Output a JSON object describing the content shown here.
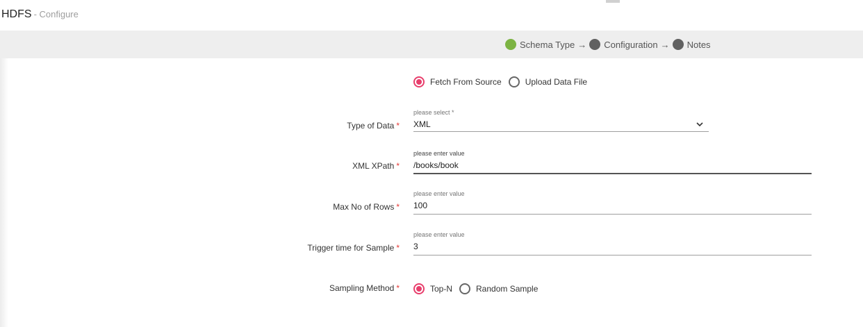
{
  "header": {
    "title": "HDFS",
    "subtitle": "- Configure"
  },
  "steps": [
    {
      "label": "Schema Type",
      "arrow": "→",
      "color": "#7cb342"
    },
    {
      "label": "Configuration",
      "arrow": "→",
      "color": "#616161"
    },
    {
      "label": "Notes",
      "arrow": "",
      "color": "#616161"
    }
  ],
  "source_options": {
    "selected": "Fetch From Source",
    "options": [
      "Fetch From Source",
      "Upload Data File"
    ]
  },
  "form": {
    "type_of_data": {
      "label": "Type of Data",
      "required": "*",
      "hint": "please select *",
      "value": "XML"
    },
    "xml_xpath": {
      "label": "XML XPath",
      "required": "*",
      "hint": "please enter value",
      "value": "/books/book"
    },
    "max_rows": {
      "label": "Max No of Rows",
      "required": "*",
      "hint": "please enter value",
      "value": "100"
    },
    "trigger_time": {
      "label": "Trigger time for Sample",
      "required": "*",
      "hint": "please enter value",
      "value": "3"
    },
    "sampling_method": {
      "label": "Sampling Method",
      "required": "*",
      "selected": "Top-N",
      "options": [
        "Top-N",
        "Random Sample"
      ]
    }
  },
  "colors": {
    "accent": "#e83e6c",
    "required": "#e53935",
    "step_done": "#7cb342",
    "step_pending": "#616161"
  }
}
